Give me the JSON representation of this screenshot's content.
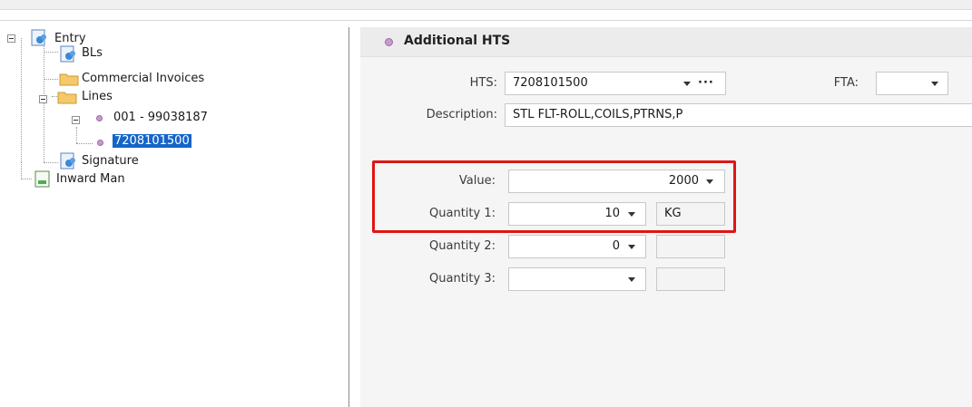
{
  "tree": {
    "items": [
      {
        "label": "Entry",
        "icon": "entry-icon"
      },
      {
        "label": "BLs",
        "icon": "document-people-icon"
      },
      {
        "label": "Commercial Invoices",
        "icon": "folder-icon"
      },
      {
        "label": "Lines",
        "icon": "folder-icon"
      },
      {
        "label": "001 - 99038187",
        "icon": "bullet-icon"
      },
      {
        "label": "7208101500",
        "icon": "bullet-icon",
        "selected": true
      },
      {
        "label": "Signature",
        "icon": "document-people-icon"
      },
      {
        "label": "Inward Man",
        "icon": "document-icon"
      }
    ]
  },
  "panel": {
    "title": "Additional HTS",
    "hts": {
      "label": "HTS:",
      "value": "7208101500",
      "more": "···"
    },
    "fta": {
      "label": "FTA:",
      "value": ""
    },
    "description": {
      "label": "Description:",
      "value": "STL FLT-ROLL,COILS,PTRNS,P"
    },
    "value": {
      "label": "Value:",
      "value": "2000"
    },
    "quantity1": {
      "label": "Quantity 1:",
      "value": "10",
      "unit": "KG"
    },
    "quantity2": {
      "label": "Quantity 2:",
      "value": "0",
      "unit": ""
    },
    "quantity3": {
      "label": "Quantity 3:",
      "value": "",
      "unit": ""
    }
  },
  "colors": {
    "selection": "#1565c8",
    "highlight": "#e01515",
    "bullet": "#c79ad0"
  }
}
